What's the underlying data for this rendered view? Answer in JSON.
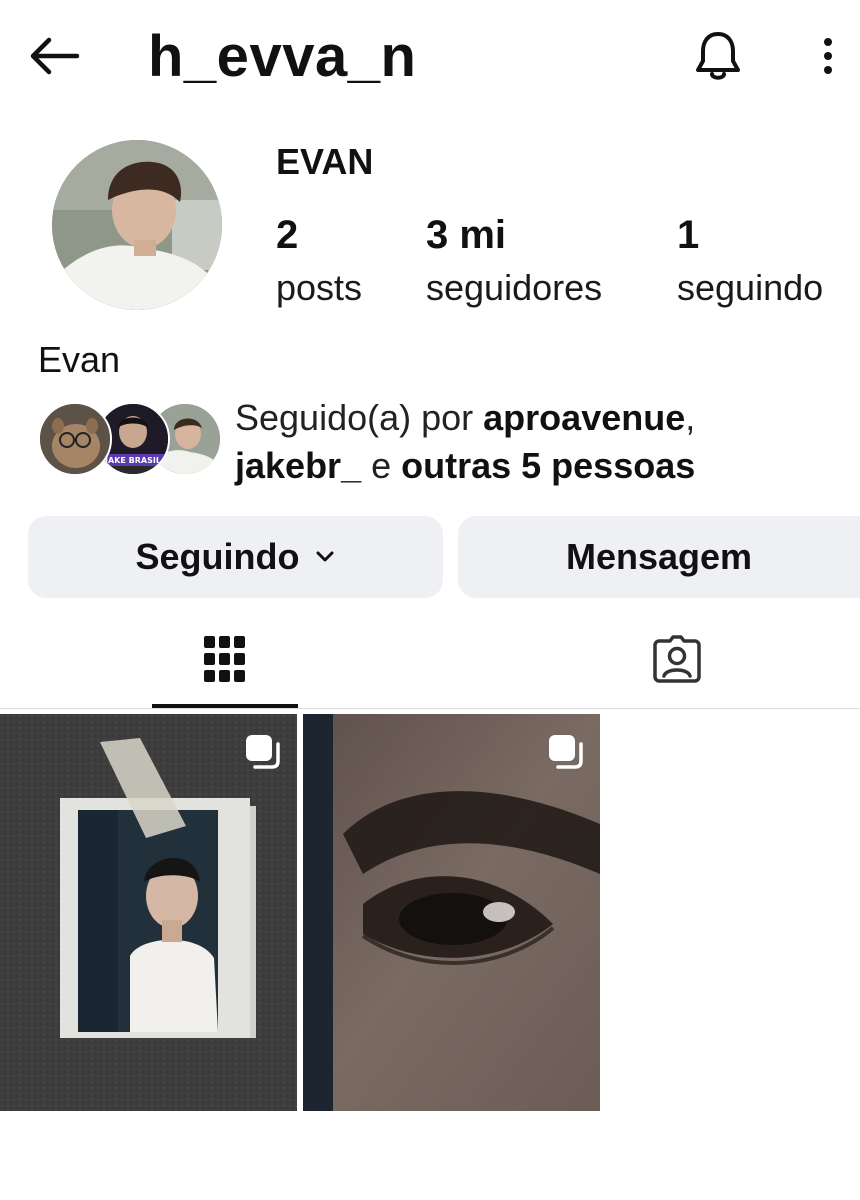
{
  "header": {
    "username": "h_evva_n",
    "icons": [
      "back-arrow-icon",
      "bell-icon",
      "more-vertical-icon"
    ]
  },
  "profile": {
    "display_name": "EVAN",
    "stats": [
      {
        "value": "2",
        "label": "posts"
      },
      {
        "value": "3 mi",
        "label": "seguidores"
      },
      {
        "value": "1",
        "label": "seguindo"
      }
    ],
    "bio_name": "Evan",
    "followed_by": {
      "prefix": "Seguido(a) por ",
      "user1": "aproavenue",
      "comma": ",",
      "user2": "jakebr_",
      "connector": " e ",
      "others": "outras 5 pessoas"
    },
    "mutual_avatar_badge": "JAKE BRASIL"
  },
  "actions": {
    "following_label": "Seguindo",
    "message_label": "Mensagem"
  },
  "tabs": [
    {
      "icon": "grid-icon",
      "active": true
    },
    {
      "icon": "tagged-user-icon",
      "active": false
    }
  ],
  "posts": [
    {
      "type": "carousel",
      "icon": "multiple-posts-icon"
    },
    {
      "type": "carousel",
      "icon": "multiple-posts-icon"
    }
  ],
  "colors": {
    "button_bg": "#eff0f4",
    "text": "#111111",
    "divider": "#dbdbdb"
  }
}
